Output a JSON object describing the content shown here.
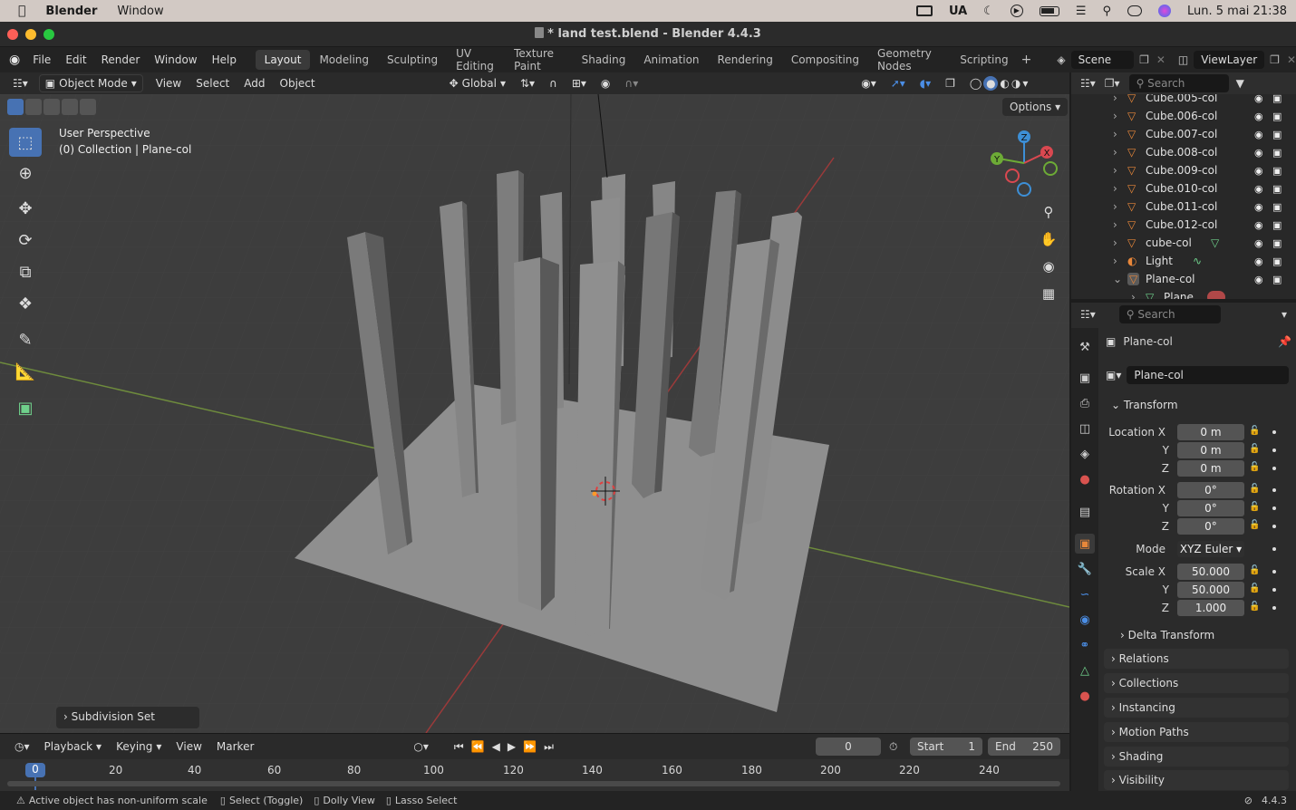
{
  "macmenu": {
    "apple": "",
    "app": "Blender",
    "window": "Window",
    "lang": "UA",
    "datetime": "Lun. 5 mai 21:38"
  },
  "window": {
    "title": "* land test.blend - Blender 4.4.3"
  },
  "topbar": {
    "menus": [
      "File",
      "Edit",
      "Render",
      "Window",
      "Help"
    ],
    "workspaces": [
      "Layout",
      "Modeling",
      "Sculpting",
      "UV Editing",
      "Texture Paint",
      "Shading",
      "Animation",
      "Rendering",
      "Compositing",
      "Geometry Nodes",
      "Scripting"
    ],
    "active_workspace": "Layout",
    "add": "+",
    "scene": "Scene",
    "viewlayer": "ViewLayer"
  },
  "viewport_header": {
    "mode": "Object Mode",
    "menus": [
      "View",
      "Select",
      "Add",
      "Object"
    ],
    "orientation": "Global",
    "options": "Options"
  },
  "viewport": {
    "perspective": "User Perspective",
    "collection": "(0) Collection | Plane-col",
    "operator_panel": "Subdivision Set"
  },
  "gizmo": {
    "x": "X",
    "y": "Y",
    "z": "Z"
  },
  "timeline": {
    "menus": [
      "Playback",
      "Keying",
      "View",
      "Marker"
    ],
    "current_frame": "0",
    "start_label": "Start",
    "start": "1",
    "end_label": "End",
    "end": "250",
    "ticks": [
      "0",
      "20",
      "40",
      "60",
      "80",
      "100",
      "120",
      "140",
      "160",
      "180",
      "200",
      "220",
      "240"
    ]
  },
  "statusbar": {
    "message": "Active object has non-uniform scale",
    "hint1": "Select (Toggle)",
    "hint2": "Dolly View",
    "hint3": "Lasso Select",
    "version": "4.4.3"
  },
  "outliner": {
    "search": "Search",
    "items": [
      {
        "name": "Cube.005-col"
      },
      {
        "name": "Cube.006-col"
      },
      {
        "name": "Cube.007-col"
      },
      {
        "name": "Cube.008-col"
      },
      {
        "name": "Cube.009-col"
      },
      {
        "name": "Cube.010-col"
      },
      {
        "name": "Cube.011-col"
      },
      {
        "name": "Cube.012-col"
      },
      {
        "name": "cube-col"
      },
      {
        "name": "Light"
      },
      {
        "name": "Plane-col"
      },
      {
        "name": "Plane"
      }
    ]
  },
  "properties": {
    "search": "Search",
    "object_name": "Plane-col",
    "object_field": "Plane-col",
    "transform": {
      "title": "Transform",
      "location_label": "Location X",
      "loc": [
        "0 m",
        "0 m",
        "0 m"
      ],
      "rotation_label": "Rotation X",
      "rot": [
        "0°",
        "0°",
        "0°"
      ],
      "mode_label": "Mode",
      "mode": "XYZ Euler",
      "scale_label": "Scale X",
      "scale": [
        "50.000",
        "50.000",
        "1.000"
      ],
      "y": "Y",
      "z": "Z",
      "delta": "Delta Transform"
    },
    "panels": [
      "Relations",
      "Collections",
      "Instancing",
      "Motion Paths",
      "Shading",
      "Visibility"
    ]
  },
  "colors": {
    "accent": "#4772b3",
    "object_orange": "#e8873a",
    "mesh_green": "#6fd08b"
  }
}
